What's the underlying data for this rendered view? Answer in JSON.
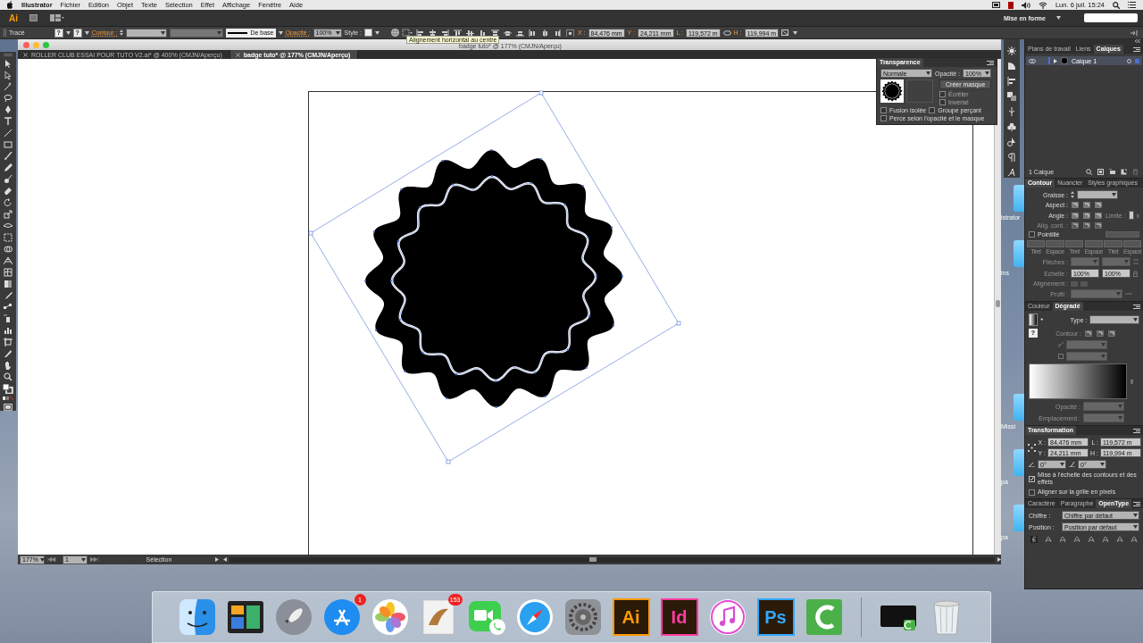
{
  "menu_bar": {
    "items": [
      {
        "label": "Illustrator",
        "kind": "app"
      },
      {
        "label": "Fichier",
        "kind": "menu"
      },
      {
        "label": "Edition",
        "kind": "menu"
      },
      {
        "label": "Objet",
        "kind": "menu"
      },
      {
        "label": "Texte",
        "kind": "menu"
      },
      {
        "label": "Sélection",
        "kind": "menu"
      },
      {
        "label": "Effet",
        "kind": "menu"
      },
      {
        "label": "Affichage",
        "kind": "menu"
      },
      {
        "label": "Fenêtre",
        "kind": "menu"
      },
      {
        "label": "Aide",
        "kind": "menu"
      }
    ],
    "clock": "Lun. 6 juil. 15:24"
  },
  "app_bar": {
    "logo": "Ai",
    "workspace": "Mise en forme"
  },
  "control_bar": {
    "selection": "Tracé",
    "fill_swatch": "?",
    "stroke_swatch": "?",
    "stroke_label": "Contour :",
    "brush": "De base",
    "opacity_label": "Opacité :",
    "opacity": "100%",
    "style_label": "Style :",
    "x_label": "X :",
    "x": "84,476 mm",
    "y_label": "Y :",
    "y": "24,211 mm",
    "w_label": "L :",
    "w": "119,572 m",
    "h_label": "H :",
    "h": "119,994 m"
  },
  "tooltip": "Alignement horizontal au centre",
  "document": {
    "title": "badge tuto* @ 177% (CMJN/Aperçu)",
    "tabs": [
      {
        "label": "ROLLER CLUB ESSAI POUR TUTO V2.ai* @ 400% (CMJN/Aperçu)",
        "selected": false
      },
      {
        "label": "badge tuto* @ 177% (CMJN/Aperçu)",
        "selected": true
      }
    ],
    "zoom": "177%",
    "artboard": "1",
    "status": "Sélection"
  },
  "transparency_panel": {
    "title": "Transparence",
    "mode": "Normale",
    "opacity_label": "Opacité :",
    "opacity": "100%",
    "make_mask": "Créer masque",
    "clip": {
      "label": "Écrêter",
      "checked": false
    },
    "invert": {
      "label": "Inversé",
      "checked": false
    },
    "options": [
      {
        "label": "Fusion isolée",
        "checked": false
      },
      {
        "label": "Groupe perçant",
        "checked": false
      },
      {
        "label": "Perce selon l'opacité et le masque",
        "checked": false
      }
    ]
  },
  "layers_panel": {
    "tabs": [
      {
        "label": "Plans de travail",
        "selected": false
      },
      {
        "label": "Liens",
        "selected": false
      },
      {
        "label": "Calques",
        "selected": true
      }
    ],
    "layers": [
      {
        "name": "Calque 1",
        "expanded": false
      }
    ],
    "footer": "1 Calque"
  },
  "stroke_panel": {
    "tabs": [
      {
        "label": "Contour",
        "selected": true
      },
      {
        "label": "Nuancier",
        "selected": false
      },
      {
        "label": "Styles graphiques",
        "selected": false
      }
    ],
    "weight_label": "Graisse :",
    "cap_label": "Aspect :",
    "corner_label": "Angle :",
    "limit_label": "Limite :",
    "limit_unit": "x",
    "align_label": "Alig. cont. :",
    "dashed": {
      "label": "Pointillé",
      "checked": false
    },
    "dash_labels": [
      "Tiret",
      "Espace",
      "Tiret",
      "Espace",
      "Tiret",
      "Espace"
    ],
    "arrows_label": "Flèches :",
    "scale_label": "Echelle :",
    "scale_start": "100%",
    "scale_end": "100%",
    "alignment_label": "Alignement :",
    "profile_label": "Profil :"
  },
  "gradient_panel": {
    "tabs": [
      {
        "label": "Couleur",
        "selected": false
      },
      {
        "label": "Dégradé",
        "selected": true
      }
    ],
    "type_label": "Type :",
    "stroke_label": "Contour :",
    "fill_stroke": "?",
    "opacity_label": "Opacité :",
    "location_label": "Emplacement :"
  },
  "transform_panel": {
    "title": "Transformation",
    "x_label": "X :",
    "x": "84,476 mm",
    "y_label": "Y :",
    "y": "24,211 mm",
    "w_label": "L :",
    "w": "119,572 m",
    "h_label": "H :",
    "h": "119,994 m",
    "rotate": "0°",
    "shear": "0°",
    "options": [
      {
        "label": "Mise à l'échelle des contours et des effets",
        "checked": true
      },
      {
        "label": "Aligner sur la grille en pixels",
        "checked": false
      }
    ]
  },
  "opentype_panel": {
    "tabs": [
      {
        "label": "Caractère",
        "selected": false
      },
      {
        "label": "Paragraphe",
        "selected": false
      },
      {
        "label": "OpenType",
        "selected": true
      }
    ],
    "figure_label": "Chiffre :",
    "figure": "Chiffre par défaut",
    "position_label": "Position :",
    "position": "Position par défaut"
  },
  "desktop_icons": [
    {
      "label": "istrator"
    },
    {
      "label": "ins"
    },
    {
      "label": "Missi"
    },
    {
      "label": "pa"
    },
    {
      "label": "pa"
    }
  ],
  "dock": [
    {
      "kind": "finder"
    },
    {
      "kind": "screens"
    },
    {
      "kind": "rocket"
    },
    {
      "kind": "appstore",
      "badge": "1"
    },
    {
      "kind": "photos"
    },
    {
      "kind": "mail",
      "badge": "153"
    },
    {
      "kind": "facetime"
    },
    {
      "kind": "safari"
    },
    {
      "kind": "gear"
    },
    {
      "kind": "letters",
      "label": "Ai",
      "color": "#ff9a00"
    },
    {
      "kind": "letters",
      "label": "Id",
      "color": "#ff3da0"
    },
    {
      "kind": "music"
    },
    {
      "kind": "letters",
      "label": "Ps",
      "color": "#31a8ff"
    },
    {
      "kind": "camtasia"
    },
    {
      "kind": "separator"
    },
    {
      "kind": "monitor"
    },
    {
      "kind": "trash"
    }
  ]
}
